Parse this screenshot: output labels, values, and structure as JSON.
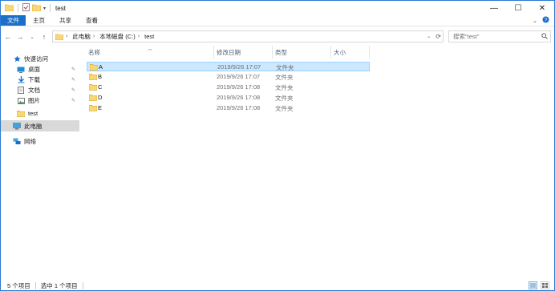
{
  "window": {
    "title": "test"
  },
  "title_controls": {
    "minimize": "—",
    "maximize": "☐",
    "close": "✕"
  },
  "ribbon": {
    "tabs": [
      "文件",
      "主页",
      "共享",
      "查看"
    ]
  },
  "address": {
    "segments": [
      "此电脑",
      "本地磁盘 (C:)",
      "test"
    ]
  },
  "search": {
    "placeholder": "搜索\"test\""
  },
  "sidebar": {
    "items": [
      {
        "label": "快速访问",
        "icon": "star-icon"
      },
      {
        "label": "桌面",
        "icon": "desktop-icon",
        "pinned": true
      },
      {
        "label": "下载",
        "icon": "download-icon",
        "pinned": true
      },
      {
        "label": "文档",
        "icon": "document-icon",
        "pinned": true
      },
      {
        "label": "图片",
        "icon": "pictures-icon",
        "pinned": true
      },
      {
        "label": "test",
        "icon": "folder-icon"
      },
      {
        "label": "此电脑",
        "icon": "computer-icon",
        "selected": true
      },
      {
        "label": "网络",
        "icon": "network-icon"
      }
    ]
  },
  "columns": {
    "name": "名称",
    "date": "修改日期",
    "type": "类型",
    "size": "大小"
  },
  "files": [
    {
      "name": "A",
      "date": "2019/9/26 17:07",
      "type": "文件夹",
      "selected": true
    },
    {
      "name": "B",
      "date": "2019/9/26 17:07",
      "type": "文件夹"
    },
    {
      "name": "C",
      "date": "2019/9/26 17:08",
      "type": "文件夹"
    },
    {
      "name": "D",
      "date": "2019/9/26 17:08",
      "type": "文件夹"
    },
    {
      "name": "E",
      "date": "2019/9/26 17:08",
      "type": "文件夹"
    }
  ],
  "status": {
    "count": "5 个项目",
    "selection": "选中 1 个项目"
  },
  "colors": {
    "accent": "#1a6fc9",
    "selection": "#cce8ff",
    "folder": "#f8d775"
  }
}
